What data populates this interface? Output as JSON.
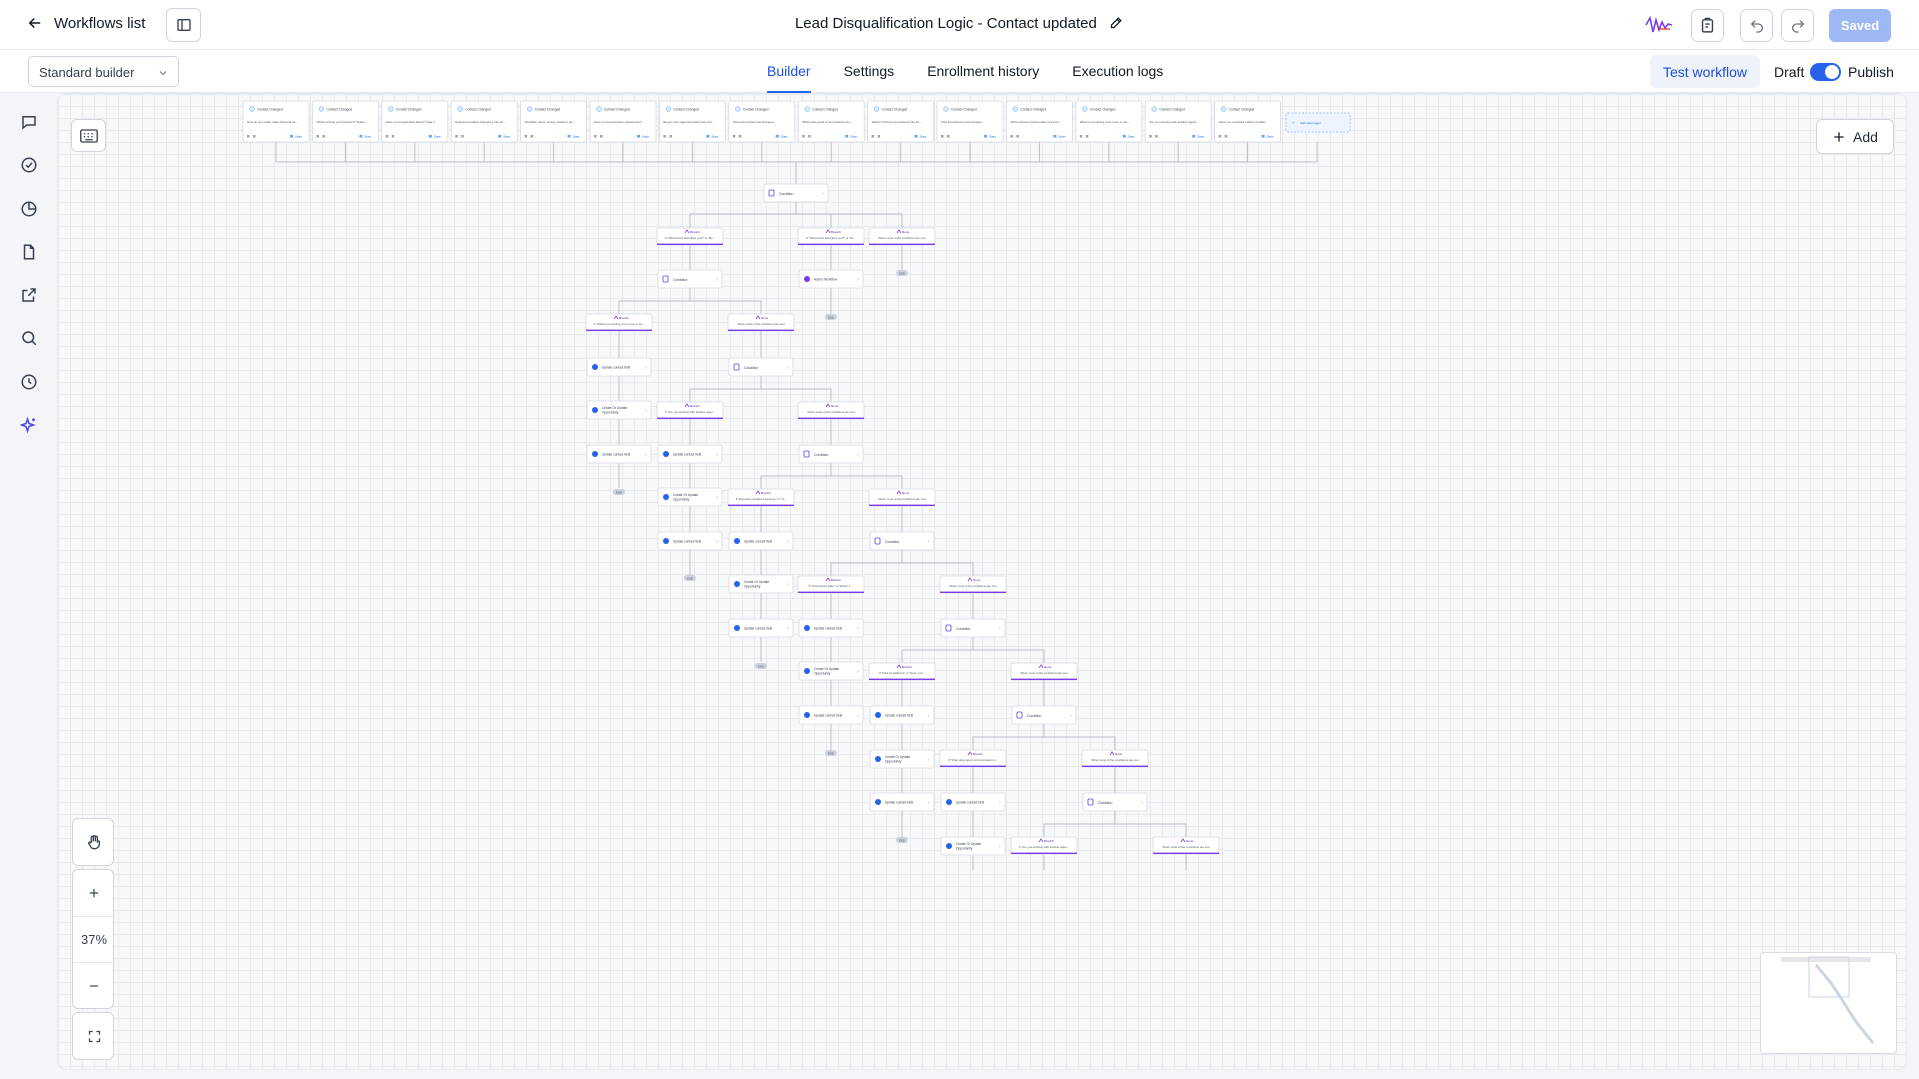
{
  "header": {
    "back_label": "Workflows list",
    "workflow_title": "Lead Disqualification Logic - Contact updated",
    "saved_label": "Saved"
  },
  "subbar": {
    "builder_mode": "Standard builder",
    "tabs": [
      {
        "label": "Builder",
        "active": true
      },
      {
        "label": "Settings",
        "active": false
      },
      {
        "label": "Enrollment history",
        "active": false
      },
      {
        "label": "Execution logs",
        "active": false
      }
    ],
    "test_label": "Test workflow",
    "draft_label": "Draft",
    "publish_label": "Publish",
    "publish_on": true
  },
  "canvas": {
    "add_label": "Add",
    "zoom_level": "37%",
    "trigger_header": "Contact Changed",
    "trigger_stats": "Stats",
    "add_trigger_label": "Add new trigger",
    "triggers": [
      "How do you make major financial de...",
      "What's driving your decision? Select...",
      "Have you bought land before? Has c...",
      "Expected updates frequency has ch...",
      "Flexibility (price, timing, location) ha...",
      "Open to representation agreement? ...",
      "Buyers: Pre-approval status has cha...",
      "Occurrence Date has changed",
      "What does good communication loo...",
      "Sellers: Pricing expectations has ch...",
      "Past Frustrations has changed",
      "What outcome would make this succ...",
      "What is prompting your move or sal...",
      "Are you working with another agent...",
      "Have you reviewed market conditio..."
    ],
    "labels": {
      "condition": "Condition",
      "branch": "Branch",
      "none": "None",
      "none_text": "When none of the conditions are met",
      "update_field": "Update contact field",
      "opportunity": "Create Or Update Opportunity",
      "add_workflow": "Add to Workflow",
      "end": "END"
    },
    "branch_texts": [
      "If \"Which best describes you?\" is \"Bu...",
      "If \"Which best describes you?\" is \"Se...",
      "If \"What is prompting your move or sa...",
      "If \"Are you working with another agen...",
      "If \"Expected updates frequency\" is \"O...",
      "If \"Occurrence Date\" is \"Within 1 ...",
      "If \"Past Frustrations\" is \"Sure, I ca...",
      "If \"What does good communication lo...",
      "If \"Are you working with another agen..."
    ]
  },
  "colors": {
    "accent": "#2563eb",
    "branch_purple": "#7c3aed",
    "saved_bg": "#9db8f5"
  }
}
